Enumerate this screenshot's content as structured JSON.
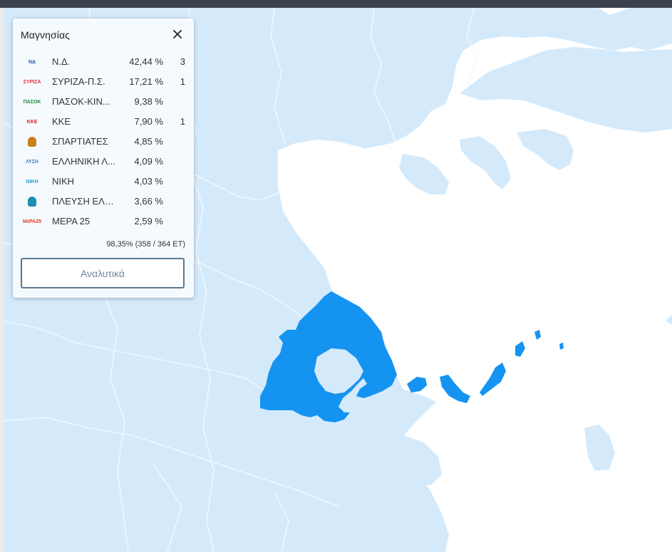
{
  "panel": {
    "title": "Μαγνησίας",
    "counted": "98,35% (358 / 364 ΕΤ)",
    "details_label": "Αναλυτικά"
  },
  "parties": [
    {
      "name": "Ν.Δ.",
      "pct": "42,44 %",
      "seats": "3",
      "logo": "nd-logo",
      "logo_text": "ΝΔ",
      "color": "#1e5aa8"
    },
    {
      "name": "ΣΥΡΙΖΑ-Π.Σ.",
      "pct": "17,21 %",
      "seats": "1",
      "logo": "syriza-logo",
      "logo_text": "ΣΥΡΙΖΑ",
      "color": "#e0304a"
    },
    {
      "name": "ΠΑΣΟΚ-ΚΙΝ...",
      "pct": "9,38 %",
      "seats": "",
      "logo": "pasok-logo",
      "logo_text": "ΠΑΣΟΚ",
      "color": "#1a8a3a"
    },
    {
      "name": "ΚΚΕ",
      "pct": "7,90 %",
      "seats": "1",
      "logo": "kke-logo",
      "logo_text": "ΚΚΕ",
      "color": "#d8202a"
    },
    {
      "name": "ΣΠΑΡΤΙΑΤΕΣ",
      "pct": "4,85 %",
      "seats": "",
      "logo": "spartiates-logo",
      "logo_text": "",
      "color": "#c8801a"
    },
    {
      "name": "ΕΛΛΗΝΙΚΗ Λ...",
      "pct": "4,09 %",
      "seats": "",
      "logo": "elliniki-lysi-logo",
      "logo_text": "ΛΥΣΗ",
      "color": "#3a7fc2"
    },
    {
      "name": "ΝΙΚΗ",
      "pct": "4,03 %",
      "seats": "",
      "logo": "niki-logo",
      "logo_text": "ΝΙΚΗ",
      "color": "#2a9ad8"
    },
    {
      "name": "ΠΛΕΥΣΗ ΕΛΕ...",
      "pct": "3,66 %",
      "seats": "",
      "logo": "plefsi-logo",
      "logo_text": "",
      "color": "#1c8fb0"
    },
    {
      "name": "ΜΕΡΑ 25",
      "pct": "2,59 %",
      "seats": "",
      "logo": "mera25-logo",
      "logo_text": "ΜέΡΑ25",
      "color": "#e8402a"
    }
  ],
  "map": {
    "selected_region": "Μαγνησίας",
    "colors": {
      "sea": "#ffffff",
      "land": "#d4eafb",
      "border": "#f4f9fd",
      "selected": "#1593f0"
    }
  }
}
